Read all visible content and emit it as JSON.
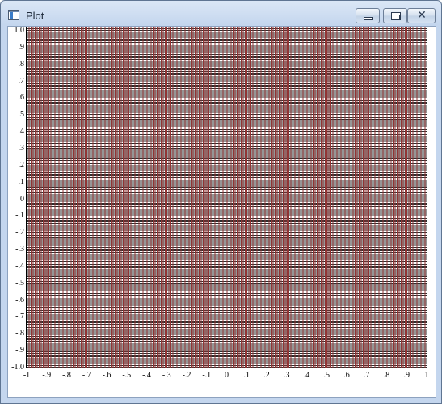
{
  "window": {
    "title": "Plot",
    "icon": "app-window-icon",
    "controls": {
      "minimize": "minimize-icon",
      "maximize": "maximize-icon",
      "close": "close-icon"
    }
  },
  "chart_data": {
    "type": "heatmap",
    "grid": true,
    "grid_color": "#8b2a2a",
    "xlim": [
      -1,
      1
    ],
    "ylim": [
      -1.0,
      1.0
    ],
    "x_tick_labels": [
      "-1",
      "-.9",
      "-.8",
      "-.7",
      "-.6",
      "-.5",
      "-.4",
      "-.3",
      "-.2",
      "-.1",
      "0",
      ".1",
      ".2",
      ".3",
      ".4",
      ".5",
      ".6",
      ".7",
      ".8",
      ".9",
      "1"
    ],
    "y_tick_labels": [
      "1.0",
      ".9",
      ".8",
      ".7",
      ".6",
      ".5",
      ".4",
      ".3",
      ".2",
      ".1",
      "0",
      "-.1",
      "-.2",
      "-.3",
      "-.4",
      "-.5",
      "-.6",
      "-.7",
      "-.8",
      "-.9",
      "-1.0"
    ]
  }
}
